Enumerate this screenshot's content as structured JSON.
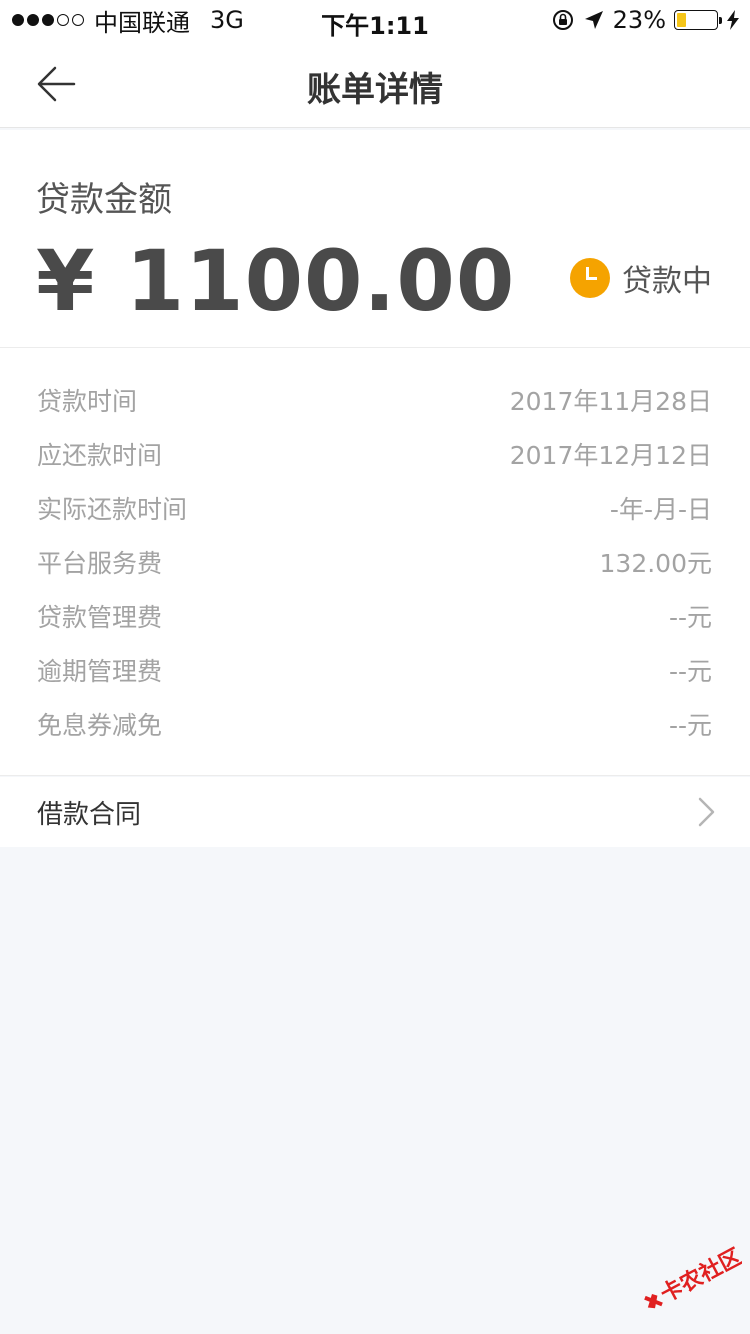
{
  "status_bar": {
    "carrier": "中国联通",
    "network": "3G",
    "time": "下午1:11",
    "battery_text": "23%",
    "battery_level": 0.23,
    "signal_bars": 3,
    "signal_total": 5,
    "icons": [
      "rotation-lock-icon",
      "location-arrow-icon",
      "battery-icon",
      "charging-bolt-icon"
    ]
  },
  "nav": {
    "title": "账单详情",
    "back_icon": "back-arrow-icon"
  },
  "loan": {
    "amount_label": "贷款金额",
    "amount": "¥ 1100.00",
    "status": "贷款中",
    "status_icon": "clock-icon",
    "status_color": "#f5a300"
  },
  "details": [
    {
      "label": "贷款时间",
      "value": "2017年11月28日"
    },
    {
      "label": "应还款时间",
      "value": "2017年12月12日"
    },
    {
      "label": "实际还款时间",
      "value": "-年-月-日"
    },
    {
      "label": "平台服务费",
      "value": "132.00元"
    },
    {
      "label": "贷款管理费",
      "value": "--元"
    },
    {
      "label": "逾期管理费",
      "value": "--元"
    },
    {
      "label": "免息券减免",
      "value": "--元"
    }
  ],
  "contract": {
    "label": "借款合同",
    "chevron_icon": "chevron-right-icon"
  },
  "watermark": {
    "text": "卡农社区",
    "color": "#e02020"
  }
}
